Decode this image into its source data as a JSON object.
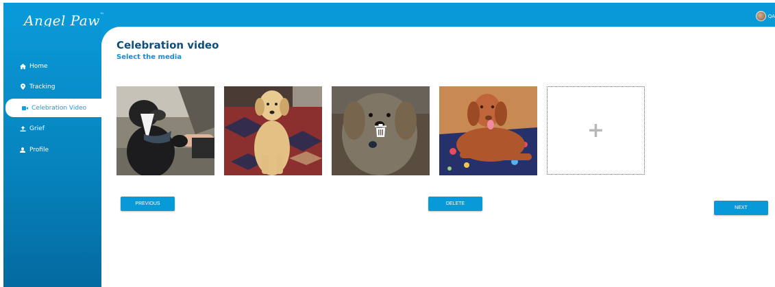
{
  "app": {
    "logo_text": "Angel Paw",
    "trademark": "™",
    "user_label": "QA"
  },
  "sidebar": {
    "items": [
      {
        "label": "Home",
        "icon": "home-icon",
        "active": false
      },
      {
        "label": "Tracking",
        "icon": "location-pin-icon",
        "active": false
      },
      {
        "label": "Celebration Video",
        "icon": "video-camera-icon",
        "active": true
      },
      {
        "label": "Grief",
        "icon": "upload-icon",
        "active": false
      },
      {
        "label": "Profile",
        "icon": "person-icon",
        "active": false
      }
    ]
  },
  "page": {
    "title": "Celebration video",
    "subtitle": "Select the media"
  },
  "media": {
    "photos": [
      {
        "subject": "black and white dog shaking paw with person",
        "selected": false
      },
      {
        "subject": "golden retriever standing on hind legs on rug",
        "selected": false
      },
      {
        "subject": "golden retriever close-up with delete overlay",
        "selected": true
      },
      {
        "subject": "brown vizsla lying on colorful blanket",
        "selected": false
      }
    ],
    "add_symbol": "+",
    "overlay_icon": "trash-icon"
  },
  "actions": {
    "previous": "PREVIOUS",
    "delete": "DELETE",
    "next": "NEXT"
  },
  "colors": {
    "primary": "#0899d9",
    "title": "#0d4f7a",
    "subtitle": "#0d8fd0"
  }
}
